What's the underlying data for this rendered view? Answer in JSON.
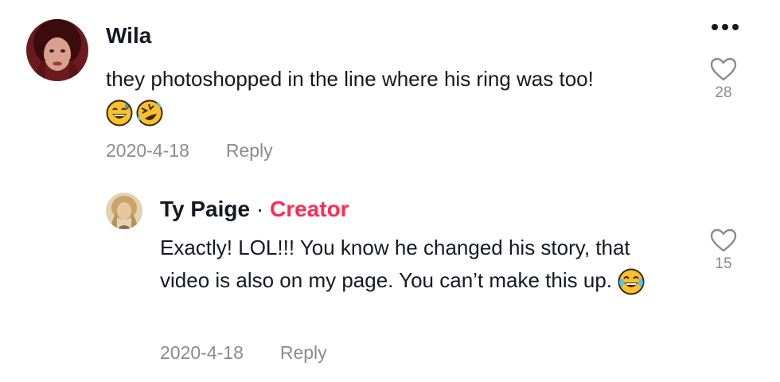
{
  "comment": {
    "username": "Wila",
    "text": "they photoshopped in the line where his ring was too!",
    "emojis": [
      "grinning-sweat-emoji",
      "rolling-laughing-emoji"
    ],
    "date": "2020-4-18",
    "reply_label": "Reply",
    "likes": "28",
    "more_icon": "more-dots-icon"
  },
  "reply": {
    "username": "Ty Paige",
    "separator": "·",
    "badge": "Creator",
    "text": "Exactly! LOL!!! You know he changed his story, that video is also on my page. You can’t make this up.",
    "emojis": [
      "tears-of-joy-emoji"
    ],
    "date": "2020-4-18",
    "reply_label": "Reply",
    "likes": "15"
  },
  "colors": {
    "creator_badge": "#fe2c55",
    "meta_text": "#8a8b91",
    "primary_text": "#161823"
  }
}
